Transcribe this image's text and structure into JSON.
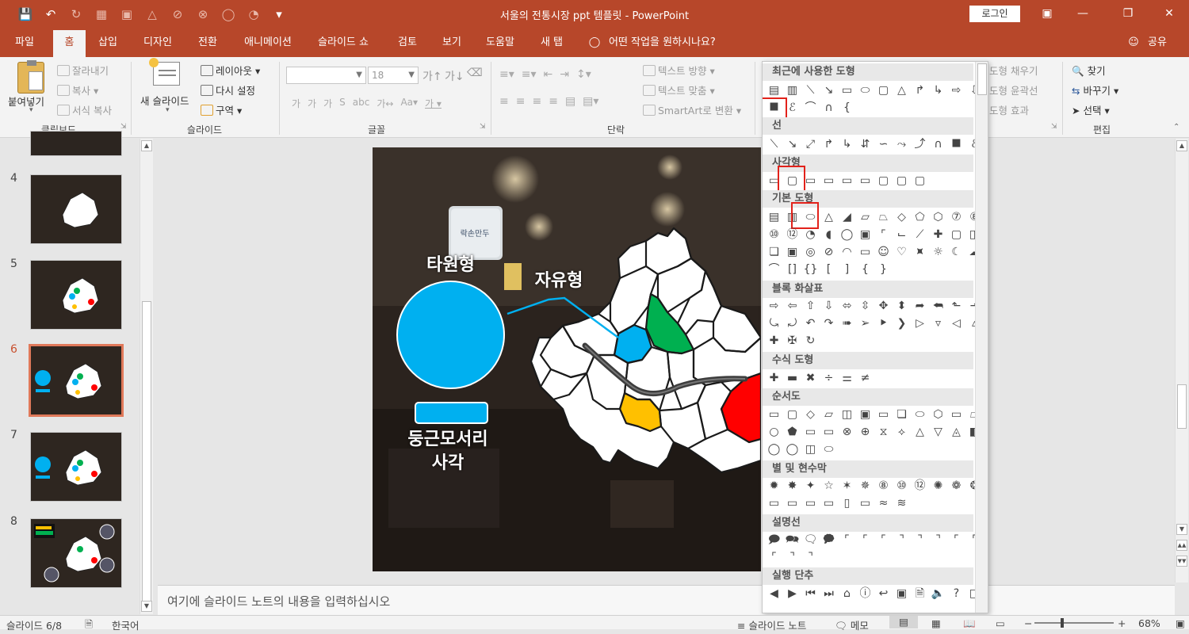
{
  "window": {
    "title": "서울의 전통시장 ppt 템플릿 - PowerPoint",
    "login_label": "로그인",
    "share_label": "공유"
  },
  "tabs": [
    "파일",
    "홈",
    "삽입",
    "디자인",
    "전환",
    "애니메이션",
    "슬라이드 쇼",
    "검토",
    "보기",
    "도움말",
    "새 탭"
  ],
  "active_tab": "홈",
  "tell_me": "어떤 작업을 원하시나요?",
  "ribbon": {
    "clipboard": {
      "paste": "붙여넣기",
      "cut": "잘라내기",
      "copy": "복사",
      "format_painter": "서식 복사",
      "label": "클립보드"
    },
    "slides": {
      "new_slide": "새 슬라이드",
      "layout": "레이아웃",
      "reset": "다시 설정",
      "section": "구역",
      "label": "슬라이드"
    },
    "font": {
      "size": "18",
      "label": "글꼴"
    },
    "paragraph": {
      "text_direction": "텍스트 방향",
      "align_text": "텍스트 맞춤",
      "smartart": "SmartArt로 변환",
      "label": "단락"
    },
    "drawing": {
      "fill": "도형 채우기",
      "outline": "도형 윤곽선",
      "effects": "도형 효과"
    },
    "editing": {
      "find": "찾기",
      "replace": "바꾸기",
      "select": "선택",
      "label": "편집"
    }
  },
  "thumbnails": [
    {
      "num": "4"
    },
    {
      "num": "5"
    },
    {
      "num": "6",
      "selected": true
    },
    {
      "num": "7"
    },
    {
      "num": "8"
    }
  ],
  "slide": {
    "ellipse_label": "타원형",
    "freeform_label": "자유형",
    "rounded_rect_label_line1": "둥근모서리",
    "rounded_rect_label_line2": "사각",
    "sign_text": "락손만두",
    "colors": {
      "blue": "#00b0f0",
      "green": "#00b050",
      "red": "#ff0000",
      "yellow": "#ffc000"
    }
  },
  "notes_placeholder": "여기에 슬라이드 노트의 내용을 입력하십시오",
  "shapes_panel": {
    "sections": [
      "최근에 사용한 도형",
      "선",
      "사각형",
      "기본 도형",
      "블록 화살표",
      "수식 도형",
      "순서도",
      "별 및 현수막",
      "설명선",
      "실행 단추"
    ]
  },
  "status": {
    "slide_info": "슬라이드 6/8",
    "language": "한국어",
    "notes_btn": "슬라이드 노트",
    "comments_btn": "메모",
    "zoom": "68%"
  }
}
